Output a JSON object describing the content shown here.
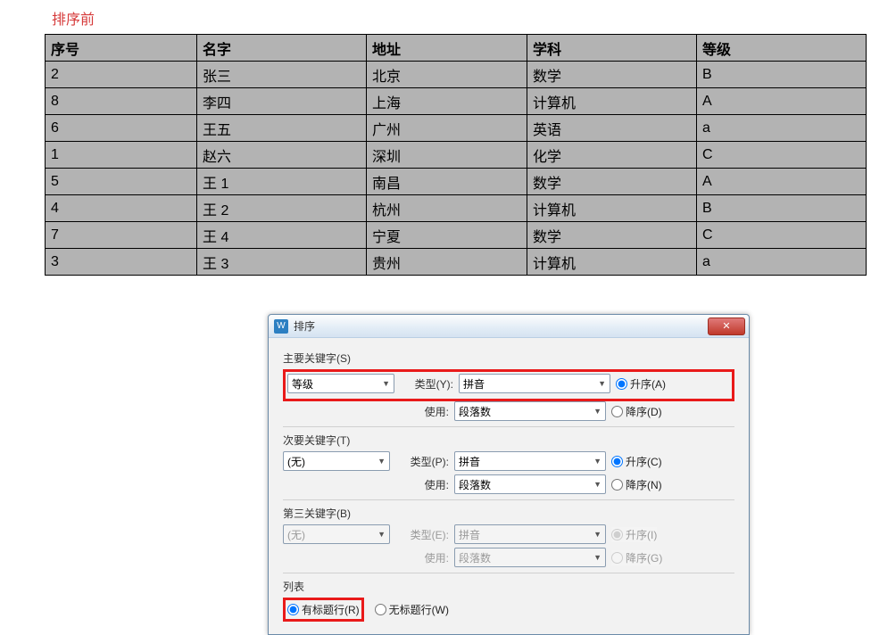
{
  "caption": "排序前",
  "table": {
    "headers": [
      "序号",
      "名字",
      "地址",
      "学科",
      "等级"
    ],
    "rows": [
      [
        "2",
        "张三",
        "北京",
        "数学",
        "B"
      ],
      [
        "8",
        "李四",
        "上海",
        "计算机",
        "A"
      ],
      [
        "6",
        "王五",
        "广州",
        "英语",
        "a"
      ],
      [
        "1",
        "赵六",
        "深圳",
        "化学",
        "C"
      ],
      [
        "5",
        "王 1",
        "南昌",
        "数学",
        "A"
      ],
      [
        "4",
        "王 2",
        "杭州",
        "计算机",
        "B"
      ],
      [
        "7",
        "王 4",
        "宁夏",
        "数学",
        "C"
      ],
      [
        "3",
        "王 3",
        "贵州",
        "计算机",
        "a"
      ]
    ]
  },
  "dialog": {
    "title": "排序",
    "sections": {
      "primary": {
        "label": "主要关键字(S)",
        "key": "等级",
        "typeLabel": "类型(Y):",
        "type": "拼音",
        "asc": "升序(A)",
        "useLabel": "使用:",
        "use": "段落数",
        "desc": "降序(D)"
      },
      "secondary": {
        "label": "次要关键字(T)",
        "key": "(无)",
        "typeLabel": "类型(P):",
        "type": "拼音",
        "asc": "升序(C)",
        "useLabel": "使用:",
        "use": "段落数",
        "desc": "降序(N)"
      },
      "third": {
        "label": "第三关键字(B)",
        "key": "(无)",
        "typeLabel": "类型(E):",
        "type": "拼音",
        "asc": "升序(I)",
        "useLabel": "使用:",
        "use": "段落数",
        "desc": "降序(G)"
      }
    },
    "list": {
      "label": "列表",
      "withHeader": "有标题行(R)",
      "withoutHeader": "无标题行(W)"
    }
  }
}
